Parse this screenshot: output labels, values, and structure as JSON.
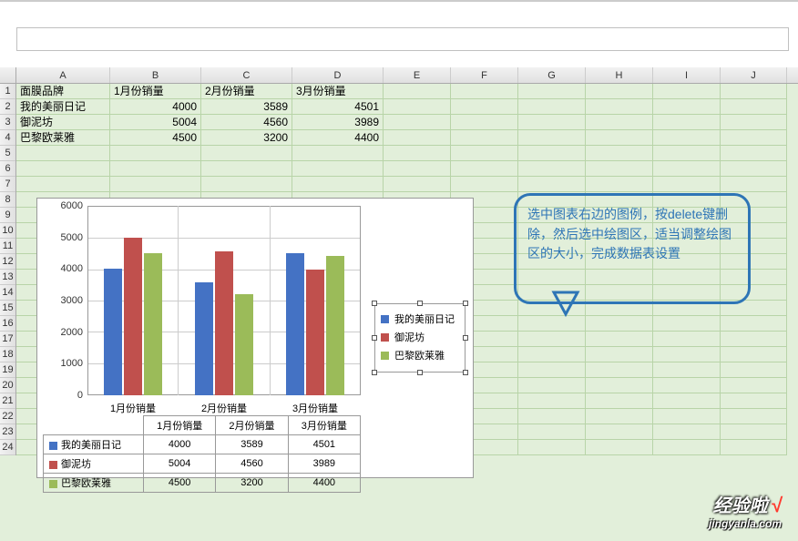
{
  "columns": [
    "A",
    "B",
    "C",
    "D",
    "E",
    "F",
    "G",
    "H",
    "I",
    "J"
  ],
  "row_count": 24,
  "table": {
    "headers": [
      "面膜品牌",
      "1月份销量",
      "2月份销量",
      "3月份销量"
    ],
    "rows": [
      {
        "label": "我的美丽日记",
        "v": [
          4000,
          3589,
          4501
        ]
      },
      {
        "label": "御泥坊",
        "v": [
          5004,
          4560,
          3989
        ]
      },
      {
        "label": "巴黎欧莱雅",
        "v": [
          4500,
          3200,
          4400
        ]
      }
    ]
  },
  "chart_data": {
    "type": "bar",
    "categories": [
      "1月份销量",
      "2月份销量",
      "3月份销量"
    ],
    "series": [
      {
        "name": "我的美丽日记",
        "values": [
          4000,
          3589,
          4501
        ],
        "color": "#4472c4"
      },
      {
        "name": "御泥坊",
        "values": [
          5004,
          4560,
          3989
        ],
        "color": "#c0504d"
      },
      {
        "name": "巴黎欧莱雅",
        "values": [
          4500,
          3200,
          4400
        ],
        "color": "#9bbb59"
      }
    ],
    "ylim": [
      0,
      6000
    ],
    "yticks": [
      0,
      1000,
      2000,
      3000,
      4000,
      5000,
      6000
    ],
    "xlabel": "",
    "ylabel": "",
    "title": "",
    "legend_position": "right"
  },
  "callout_text": "选中图表右边的图例，按delete键删除，然后选中绘图区，适当调整绘图区的大小，完成数据表设置",
  "watermark": {
    "top": "经验啦",
    "check": "√",
    "bottom": "jingyanla.com"
  }
}
